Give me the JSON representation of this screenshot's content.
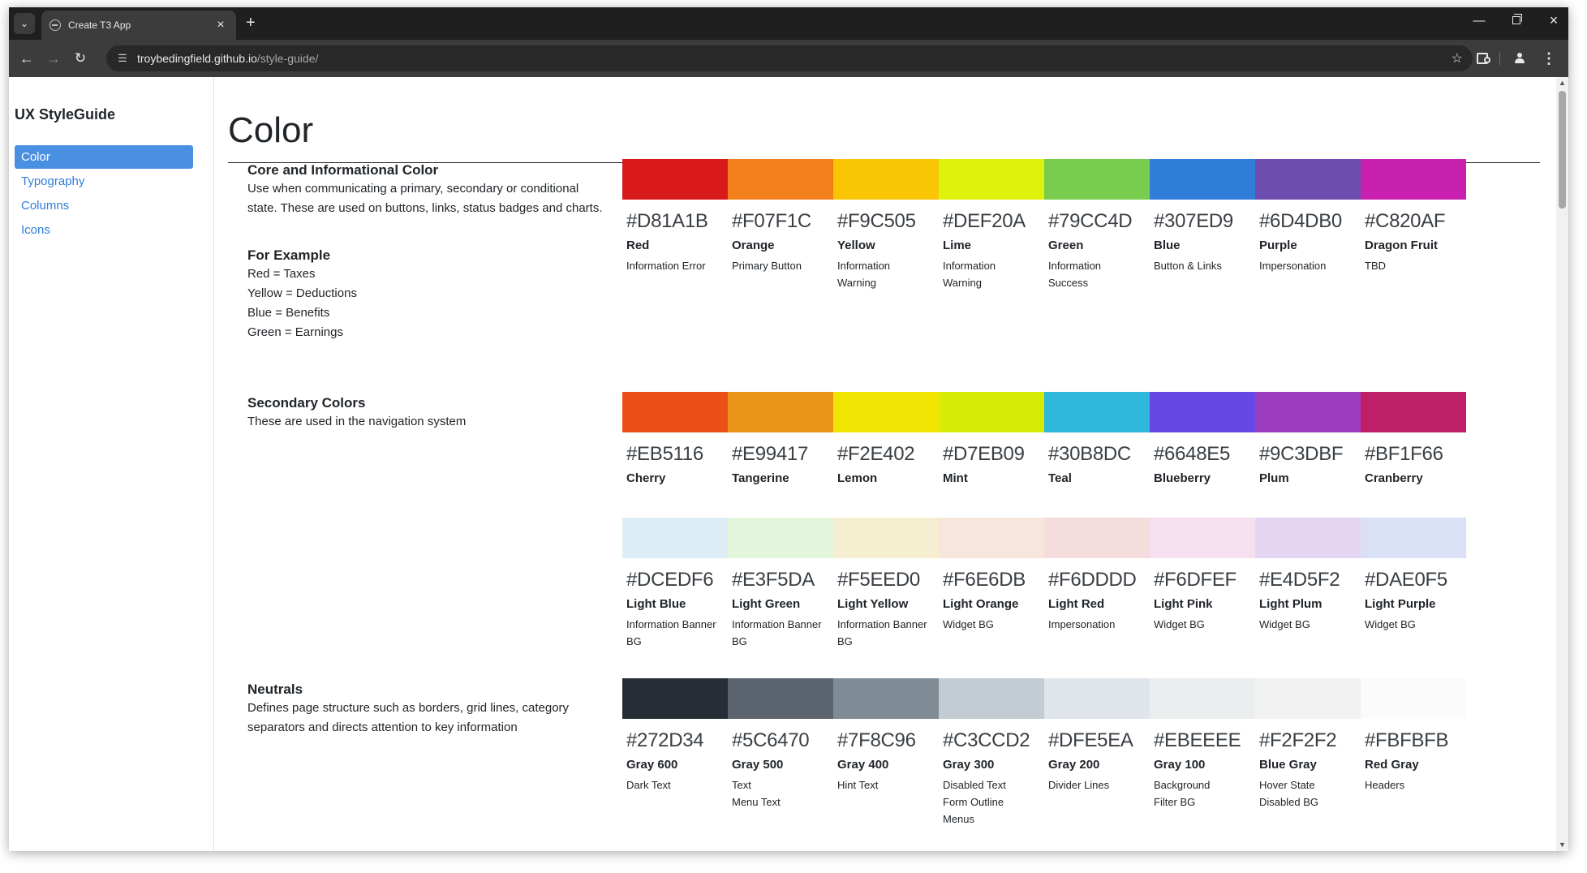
{
  "browser": {
    "tab_title": "Create T3 App",
    "url_host": "troybedingfield.github.io",
    "url_path": "/style-guide/",
    "icons": [
      "tab-search-icon",
      "globe-icon",
      "close-icon",
      "plus-icon",
      "minimize-icon",
      "maximize-icon",
      "back-icon",
      "forward-icon",
      "reload-icon",
      "site-info-icon",
      "star-icon",
      "extensions-icon",
      "profile-icon",
      "more-icon"
    ]
  },
  "sidebar": {
    "brand": "UX StyleGuide",
    "items": [
      {
        "label": "Color",
        "active": true
      },
      {
        "label": "Typography",
        "active": false
      },
      {
        "label": "Columns",
        "active": false
      },
      {
        "label": "Icons",
        "active": false
      }
    ]
  },
  "page": {
    "title": "Color"
  },
  "sections": {
    "core": {
      "title": "Core and Informational Color",
      "description": "Use when communicating a primary, secondary or conditional state. These are used on buttons, links, status badges and charts.",
      "example_title": "For Example",
      "examples": [
        "Red = Taxes",
        "Yellow = Deductions",
        "Blue = Benefits",
        "Green = Earnings"
      ],
      "swatches": [
        {
          "hex": "#D81A1B",
          "name": "Red",
          "desc": "Information Error"
        },
        {
          "hex": "#F07F1C",
          "name": "Orange",
          "desc": "Primary Button"
        },
        {
          "hex": "#F9C505",
          "name": "Yellow",
          "desc": "Information\nWarning"
        },
        {
          "hex": "#DEF20A",
          "name": "Lime",
          "desc": "Information\nWarning"
        },
        {
          "hex": "#79CC4D",
          "name": "Green",
          "desc": "Information\nSuccess"
        },
        {
          "hex": "#307ED9",
          "name": "Blue",
          "desc": "Button & Links"
        },
        {
          "hex": "#6D4DB0",
          "name": "Purple",
          "desc": "Impersonation"
        },
        {
          "hex": "#C820AF",
          "name": "Dragon Fruit",
          "desc": "TBD"
        }
      ]
    },
    "secondary": {
      "title": "Secondary Colors",
      "description": "These are used in the navigation system",
      "swatches": [
        {
          "hex": "#EB5116",
          "name": "Cherry",
          "desc": ""
        },
        {
          "hex": "#E99417",
          "name": "Tangerine",
          "desc": ""
        },
        {
          "hex": "#F2E402",
          "name": "Lemon",
          "desc": ""
        },
        {
          "hex": "#D7EB09",
          "name": "Mint",
          "desc": ""
        },
        {
          "hex": "#30B8DC",
          "name": "Teal",
          "desc": ""
        },
        {
          "hex": "#6648E5",
          "name": "Blueberry",
          "desc": ""
        },
        {
          "hex": "#9C3DBF",
          "name": "Plum",
          "desc": ""
        },
        {
          "hex": "#BF1F66",
          "name": "Cranberry",
          "desc": ""
        }
      ],
      "light_swatches": [
        {
          "hex": "#DCEDF6",
          "name": "Light Blue",
          "desc": "Information Banner\nBG"
        },
        {
          "hex": "#E3F5DA",
          "name": "Light Green",
          "desc": "Information Banner\nBG"
        },
        {
          "hex": "#F5EED0",
          "name": "Light Yellow",
          "desc": "Information Banner\nBG"
        },
        {
          "hex": "#F6E6DB",
          "name": "Light Orange",
          "desc": "Widget BG"
        },
        {
          "hex": "#F6DDDD",
          "name": "Light Red",
          "desc": "Impersonation"
        },
        {
          "hex": "#F6DFEF",
          "name": "Light Pink",
          "desc": "Widget BG"
        },
        {
          "hex": "#E4D5F2",
          "name": "Light Plum",
          "desc": "Widget BG"
        },
        {
          "hex": "#DAE0F5",
          "name": "Light Purple",
          "desc": "Widget BG"
        }
      ]
    },
    "neutrals": {
      "title": "Neutrals",
      "description": "Defines page structure such as borders, grid lines, category separators and directs attention to key information",
      "swatches": [
        {
          "hex": "#272D34",
          "name": "Gray 600",
          "desc": "Dark Text"
        },
        {
          "hex": "#5C6470",
          "name": "Gray 500",
          "desc": "Text\nMenu Text"
        },
        {
          "hex": "#7F8C96",
          "name": "Gray 400",
          "desc": "Hint Text"
        },
        {
          "hex": "#C3CCD2",
          "name": "Gray 300",
          "desc": "Disabled Text\nForm Outline\nMenus"
        },
        {
          "hex": "#DFE5EA",
          "name": "Gray 200",
          "desc": "Divider Lines"
        },
        {
          "hex": "#EBEEEE",
          "name": "Gray 100",
          "desc": "Background\nFilter BG"
        },
        {
          "hex": "#F2F2F2",
          "name": "Blue Gray",
          "desc": "Hover State\nDisabled BG"
        },
        {
          "hex": "#FBFBFB",
          "name": "Red Gray",
          "desc": "Headers"
        }
      ]
    }
  }
}
